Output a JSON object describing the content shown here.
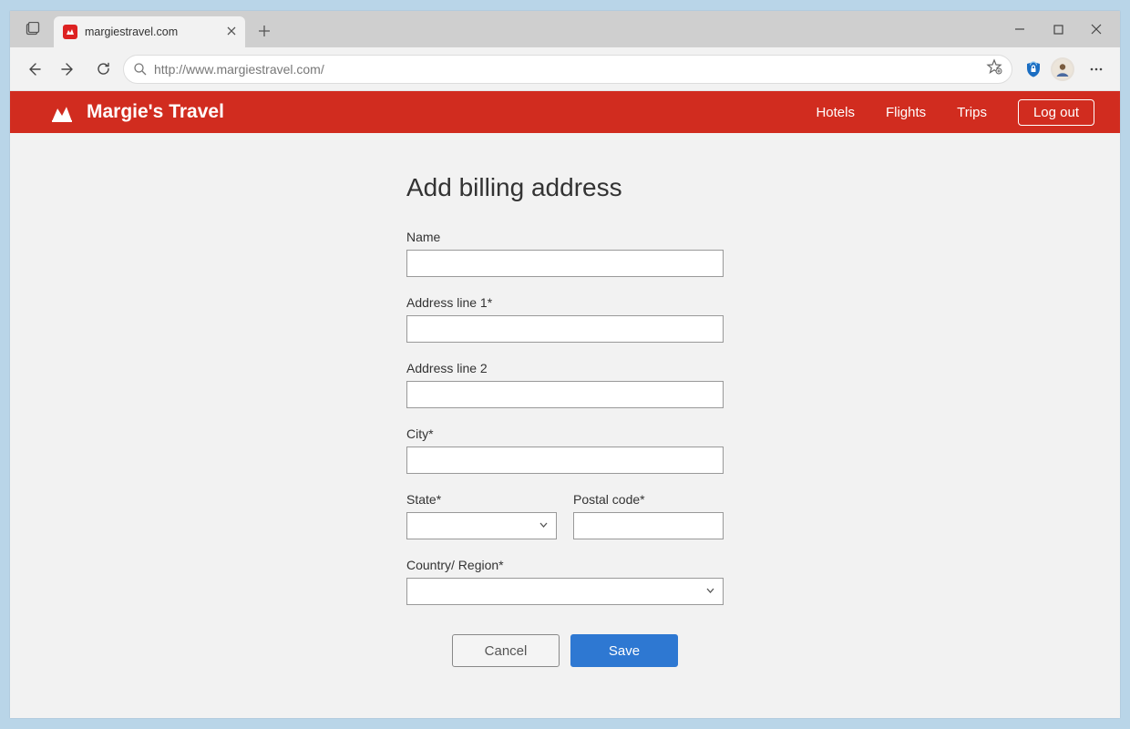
{
  "browser": {
    "tab_title": "margiestravel.com",
    "url": "http://www.margiestravel.com/"
  },
  "header": {
    "brand": "Margie's Travel",
    "nav": {
      "hotels": "Hotels",
      "flights": "Flights",
      "trips": "Trips"
    },
    "logout": "Log out"
  },
  "form": {
    "title": "Add billing address",
    "fields": {
      "name_label": "Name",
      "name_value": "",
      "addr1_label": "Address line 1*",
      "addr1_value": "",
      "addr2_label": "Address line 2",
      "addr2_value": "",
      "city_label": "City*",
      "city_value": "",
      "state_label": "State*",
      "state_value": "",
      "postal_label": "Postal code*",
      "postal_value": "",
      "country_label": "Country/ Region*",
      "country_value": ""
    },
    "buttons": {
      "cancel": "Cancel",
      "save": "Save"
    }
  }
}
